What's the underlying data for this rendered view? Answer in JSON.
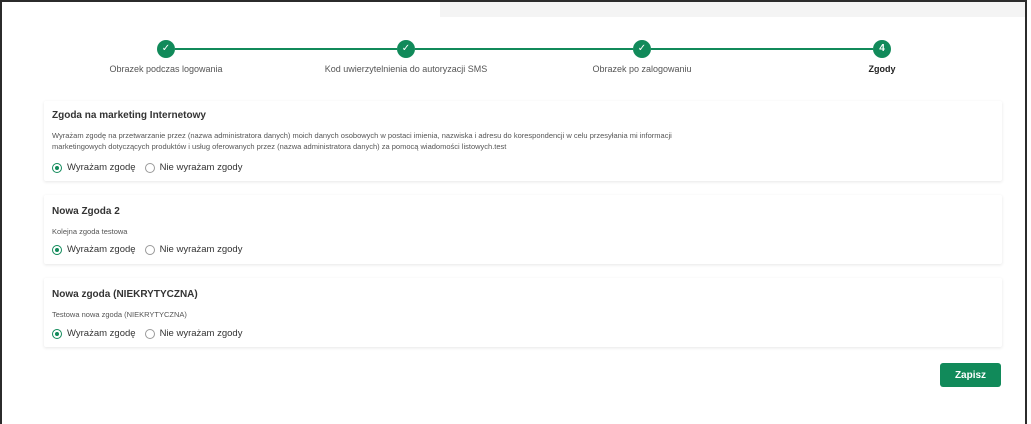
{
  "stepper": {
    "steps": [
      {
        "marker": "✓",
        "label": "Obrazek podczas logowania",
        "state": "done"
      },
      {
        "marker": "✓",
        "label": "Kod uwierzytelnienia do autoryzacji SMS",
        "state": "done"
      },
      {
        "marker": "✓",
        "label": "Obrazek po zalogowaniu",
        "state": "done"
      },
      {
        "marker": "4",
        "label": "Zgody",
        "state": "active"
      }
    ]
  },
  "consents": [
    {
      "title": "Zgoda na marketing Internetowy",
      "description": "Wyrażam zgodę na przetwarzanie przez (nazwa administratora danych) moich danych osobowych w postaci imienia, nazwiska i adresu do korespondencji w celu przesyłania mi informacji marketingowych dotyczących produktów i usług oferowanych przez (nazwa administratora danych) za pomocą wiadomości listowych.test",
      "option_yes": "Wyrażam zgodę",
      "option_no": "Nie wyrażam zgody",
      "selected": "yes"
    },
    {
      "title": "Nowa Zgoda 2",
      "description": "Kolejna zgoda testowa",
      "option_yes": "Wyrażam zgodę",
      "option_no": "Nie wyrażam zgody",
      "selected": "yes"
    },
    {
      "title": "Nowa zgoda (NIEKRYTYCZNA)",
      "description": "Testowa nowa zgoda (NIEKRYTYCZNA)",
      "option_yes": "Wyrażam zgodę",
      "option_no": "Nie wyrażam zgody",
      "selected": "yes"
    }
  ],
  "actions": {
    "save_label": "Zapisz"
  },
  "colors": {
    "accent": "#118a5a"
  }
}
